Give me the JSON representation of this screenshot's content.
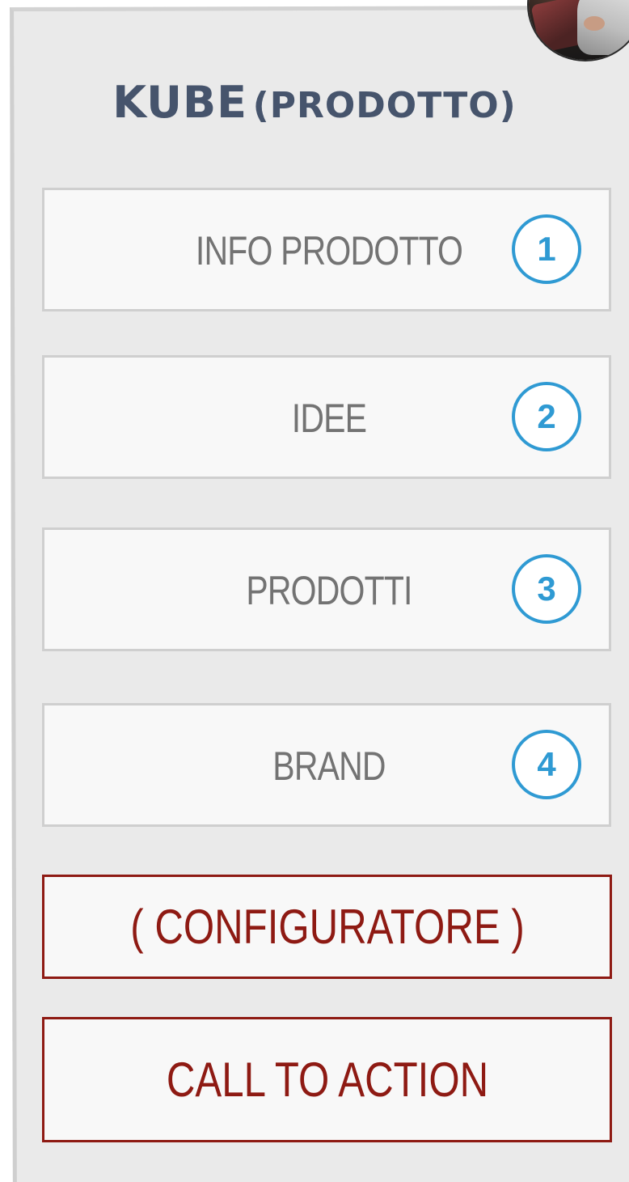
{
  "header": {
    "title_main": "KUBE",
    "title_sub": "(PRODOTTO)"
  },
  "menu": {
    "items": [
      {
        "label": "INFO PRODOTTO",
        "badge": "1"
      },
      {
        "label": "IDEE",
        "badge": "2"
      },
      {
        "label": "PRODOTTI",
        "badge": "3"
      },
      {
        "label": "BRAND",
        "badge": "4"
      }
    ]
  },
  "actions": {
    "configurator_label": "( CONFIGURATORE )",
    "cta_label": "CALL TO ACTION"
  },
  "colors": {
    "panel_bg": "#eaeaea",
    "title": "#46546c",
    "badge": "#2f9ad3",
    "cta": "#8e1a13",
    "menu_text": "#737373"
  }
}
